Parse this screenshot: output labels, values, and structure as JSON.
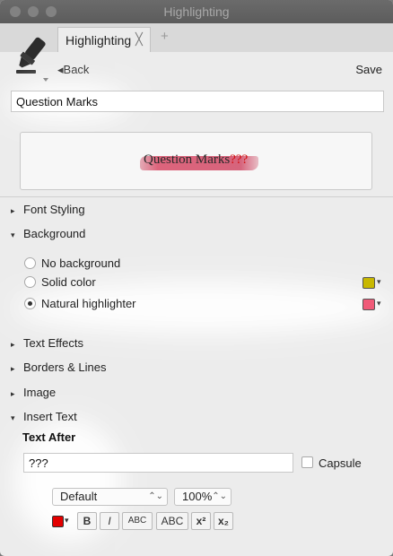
{
  "window": {
    "title": "Highlighting"
  },
  "tabs": [
    {
      "label": "Highlighting",
      "close": "╳"
    }
  ],
  "tab_add": "+",
  "toolbar": {
    "back_label": "Back",
    "back_arrow": "◂",
    "save_label": "Save"
  },
  "style_name": {
    "value": "Question Marks"
  },
  "preview": {
    "text": "Question Marks",
    "suffix": "???"
  },
  "sections": {
    "font_styling": "Font Styling",
    "background": "Background",
    "text_effects": "Text Effects",
    "borders_lines": "Borders & Lines",
    "image": "Image",
    "insert_text": "Insert Text"
  },
  "background_options": {
    "none": "No background",
    "solid": "Solid color",
    "natural": "Natural highlighter",
    "selected": "Natural highlighter"
  },
  "colors": {
    "solid_swatch": "#c8b800",
    "natural_swatch": "#f05a78",
    "text_color": "#e30000",
    "preview_question_marks": "#d20f0f"
  },
  "insert_text": {
    "heading": "Text After",
    "value": "???",
    "capsule_label": "Capsule",
    "capsule_checked": false
  },
  "font_select": {
    "value": "Default"
  },
  "size_select": {
    "value": "100%"
  },
  "format_buttons": {
    "bold": "B",
    "italic": "I",
    "small_caps": "ABC",
    "caps": "ABC",
    "superscript": "x²",
    "subscript": "x₂"
  },
  "icons": {
    "collapsed": "▸",
    "expanded": "▾",
    "dropdown": "▾",
    "stepper": "⌃⌄"
  }
}
